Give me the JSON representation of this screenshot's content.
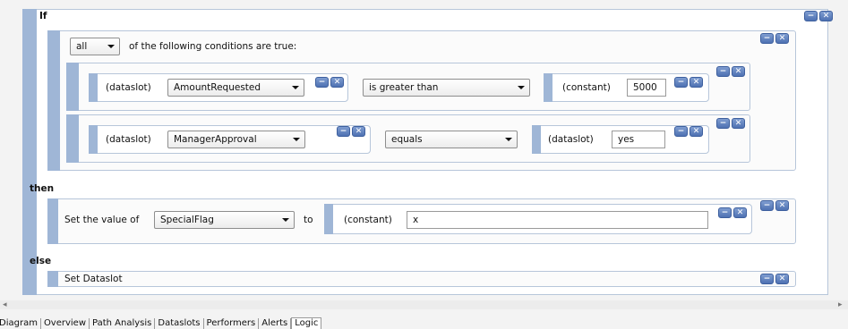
{
  "if_label": "If",
  "then_label": "then",
  "else_label": "else",
  "quantifier": {
    "selected": "all",
    "suffix": "of the following conditions are true:"
  },
  "conditions": [
    {
      "left_kind": "(dataslot)",
      "left_value": "AmountRequested",
      "operator": "is greater than",
      "right_kind": "(constant)",
      "right_value": "5000"
    },
    {
      "left_kind": "(dataslot)",
      "left_value": "ManagerApproval",
      "operator": "equals",
      "right_kind": "(dataslot)",
      "right_value": "yes"
    }
  ],
  "then_action": {
    "prefix": "Set the value of",
    "target": "SpecialFlag",
    "to_label": "to",
    "value_kind": "(constant)",
    "value": "x"
  },
  "else_action": {
    "label": "Set Dataslot"
  },
  "controls": {
    "minimize": "−",
    "close": "✕"
  },
  "tabs": [
    {
      "label": "Diagram",
      "active": false
    },
    {
      "label": "Overview",
      "active": false
    },
    {
      "label": "Path Analysis",
      "active": false
    },
    {
      "label": "Dataslots",
      "active": false
    },
    {
      "label": "Performers",
      "active": false
    },
    {
      "label": "Alerts",
      "active": false
    },
    {
      "label": "Logic",
      "active": true
    }
  ],
  "scroll": {
    "left": "◂",
    "right": "▸"
  },
  "colors": {
    "accent_bar": "#9fb6d6",
    "border": "#b7c6da",
    "button": "#4f72b2"
  }
}
